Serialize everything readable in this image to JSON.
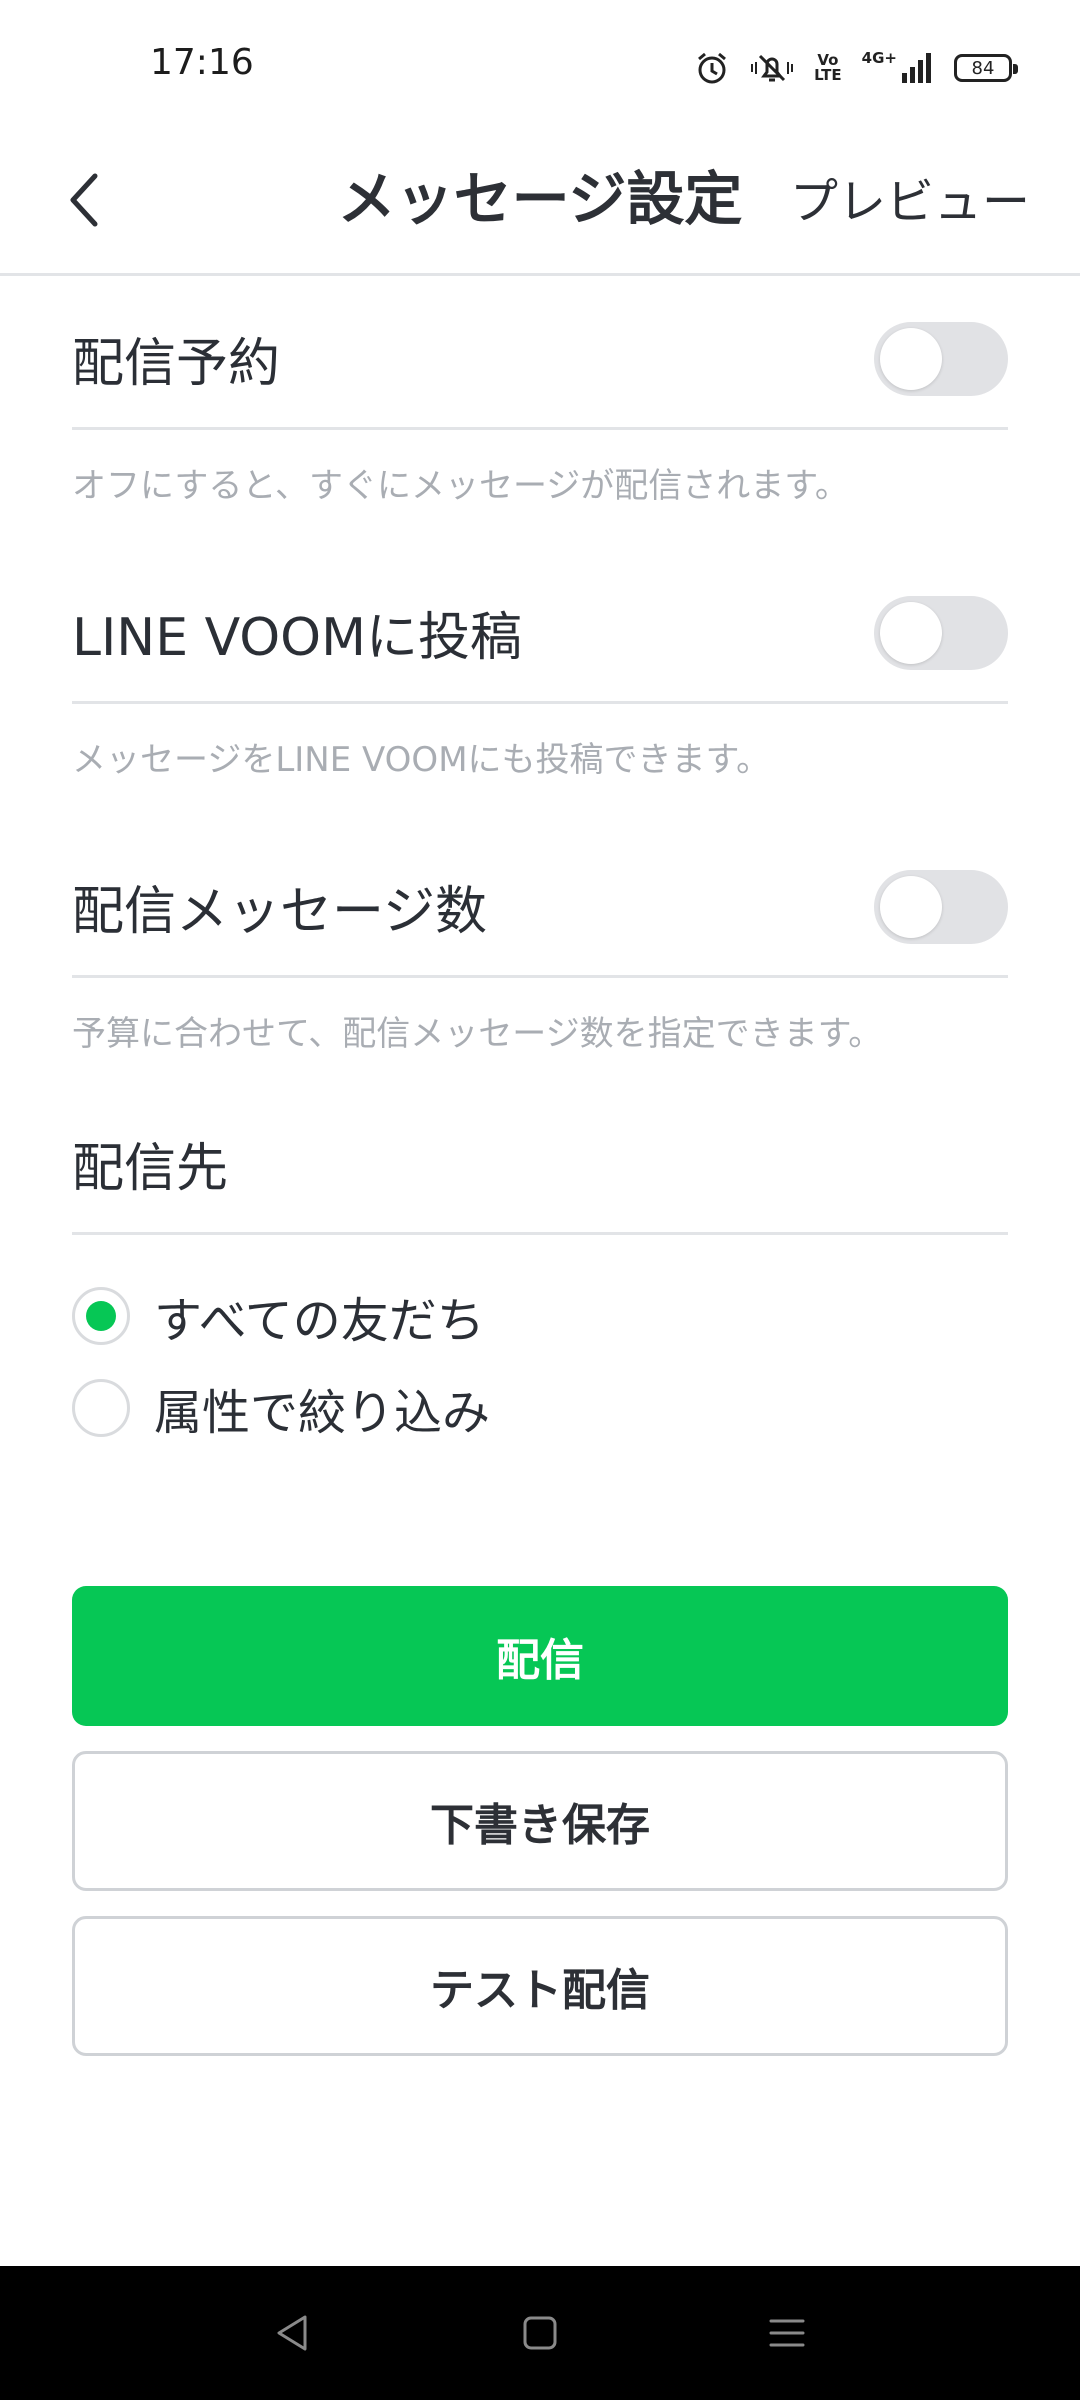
{
  "status_bar": {
    "time": "17:16",
    "battery": "84",
    "volte_top": "Vo",
    "volte_bottom": "LTE",
    "network": "4G+"
  },
  "header": {
    "title": "メッセージ設定",
    "preview": "プレビュー"
  },
  "settings": {
    "schedule": {
      "label": "配信予約",
      "description": "オフにすると、すぐにメッセージが配信されます。",
      "enabled": false
    },
    "voom": {
      "label": "LINE VOOMに投稿",
      "description": "メッセージをLINE VOOMにも投稿できます。",
      "enabled": false
    },
    "message_count": {
      "label": "配信メッセージ数",
      "description": "予算に合わせて、配信メッセージ数を指定できます。",
      "enabled": false
    },
    "recipients": {
      "label": "配信先",
      "options": [
        {
          "label": "すべての友だち",
          "selected": true
        },
        {
          "label": "属性で絞り込み",
          "selected": false
        }
      ]
    }
  },
  "buttons": {
    "send": "配信",
    "save_draft": "下書き保存",
    "test_send": "テスト配信"
  },
  "colors": {
    "accent": "#06c755",
    "toggle_off": "#e1e2e5",
    "divider": "#e2e4e7",
    "description": "#a9adb3"
  }
}
